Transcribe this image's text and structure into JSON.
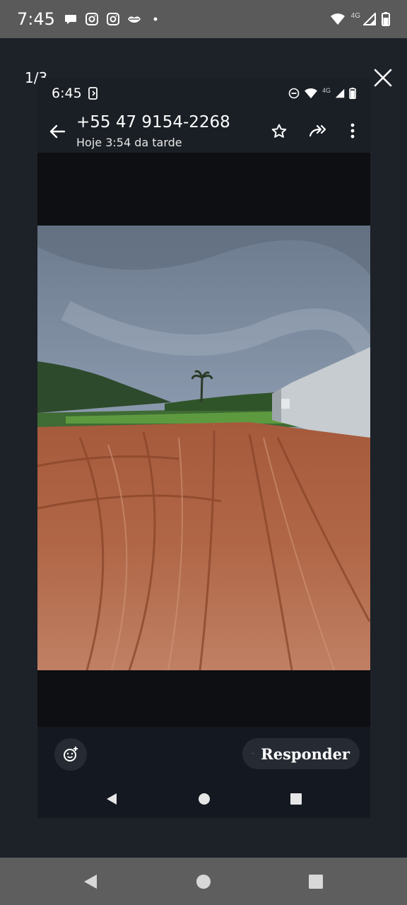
{
  "outer_status": {
    "time": "7:45",
    "notification_icons": [
      "chat-bubble-icon",
      "instagram-icon",
      "instagram-icon",
      "lips-icon",
      "dot-icon"
    ],
    "network_label": "4G"
  },
  "viewer": {
    "counter": "1/3"
  },
  "inner_screenshot": {
    "status": {
      "time": "6:45",
      "network_label": "4G"
    },
    "header": {
      "contact": "+55 47 9154-2268",
      "subtitle": "Hoje 3:54 da tarde"
    },
    "bottom": {
      "reply_label": "Responder"
    }
  },
  "colors": {
    "outer_status_bg": "#5a5a5a",
    "viewer_bg": "#1d2128",
    "inner_bar_bg": "#1a1f25",
    "button_bg": "#262b33"
  }
}
